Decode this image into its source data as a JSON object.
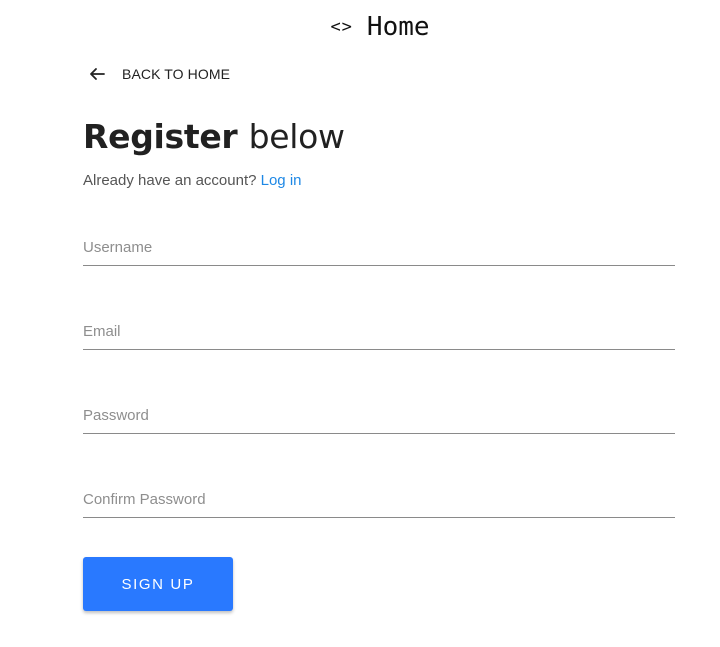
{
  "header": {
    "icon": "code-icon",
    "icon_glyph": "<>",
    "brand": "Home"
  },
  "back": {
    "icon": "arrow-left-icon",
    "label": "BACK TO HOME"
  },
  "title": {
    "strong": "Register",
    "light": "below"
  },
  "account": {
    "prompt": "Already have an account?",
    "link": "Log in"
  },
  "form": {
    "username": {
      "placeholder": "Username",
      "value": ""
    },
    "email": {
      "placeholder": "Email",
      "value": ""
    },
    "password": {
      "placeholder": "Password",
      "value": ""
    },
    "confirm_password": {
      "placeholder": "Confirm Password",
      "value": ""
    },
    "submit_label": "SIGN UP"
  },
  "colors": {
    "accent": "#2979ff",
    "link": "#1e88e5",
    "text": "#212121"
  }
}
